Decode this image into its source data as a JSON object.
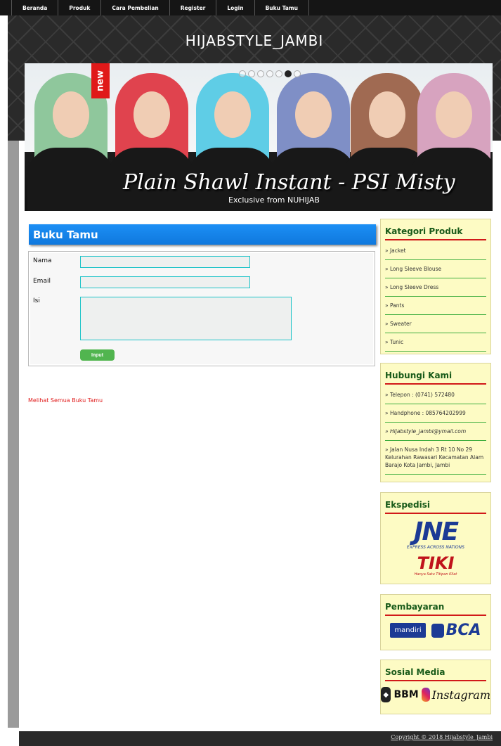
{
  "nav": {
    "items": [
      "Beranda",
      "Produk",
      "Cara Pembelian",
      "Register",
      "Login",
      "Buku Tamu"
    ]
  },
  "header": {
    "site_title": "HIJABSTYLE_JAMBI"
  },
  "banner": {
    "tag": "new",
    "caption": "Plain Shawl Instant - PSI Misty",
    "subcaption": "Exclusive from NUHIJAB",
    "hijab_colors": [
      "#8fc79c",
      "#e0434e",
      "#5fcde6",
      "#7f8fc6",
      "#a06a52",
      "#d7a3bf"
    ]
  },
  "content": {
    "title": "Buku Tamu",
    "form": {
      "name_label": "Nama",
      "email_label": "Email",
      "message_label": "Isi",
      "name_value": "",
      "email_value": "",
      "message_value": "",
      "submit_label": "Input"
    },
    "view_all_link": "Melihat Semua Buku Tamu"
  },
  "sidebar": {
    "categories": {
      "title": "Kategori Produk",
      "items": [
        "» Jacket",
        "» Long Sleeve Blouse",
        "» Long Sleeve Dress",
        "» Pants",
        "» Sweater",
        "» Tunic"
      ]
    },
    "contact": {
      "title": "Hubungi Kami",
      "items": [
        "» Telepon : (0741) 572480",
        "» Handphone : 085764202999",
        "» Hijabstyle_jambi@ymail.com",
        "» Jalan Nusa Indah 3 Rt 10 No 29 Kelurahan Rawasari Kecamatan Alam Barajo Kota Jambi, Jambi"
      ]
    },
    "shipping": {
      "title": "Ekspedisi",
      "jne": "JNE",
      "jne_sub": "EXPRESS ACROSS NATIONS",
      "tiki": "TIKI",
      "tiki_sub": "Hanya Satu Titipan Kilat"
    },
    "payment": {
      "title": "Pembayaran",
      "mandiri": "mandiri",
      "bca": "BCA"
    },
    "social": {
      "title": "Sosial Media",
      "bbm": "BBM",
      "instagram": "Instagram"
    }
  },
  "footer": {
    "copyright": "Copyright © 2018 Hijabstyle_Jambi"
  }
}
